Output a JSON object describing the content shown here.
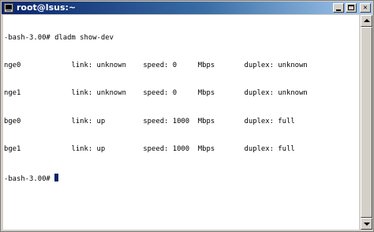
{
  "window": {
    "title": "root@lsus:~",
    "minimize_glyph": "_",
    "maximize_glyph": "□",
    "close_glyph": "✕"
  },
  "terminal": {
    "lines": [
      "-bash-3.00# dladm show-dev",
      "nge0            link: unknown    speed: 0     Mbps       duplex: unknown",
      "nge1            link: unknown    speed: 0     Mbps       duplex: unknown",
      "bge0            link: up         speed: 1000  Mbps       duplex: full",
      "bge1            link: up         speed: 1000  Mbps       duplex: full"
    ],
    "prompt": "-bash-3.00# ",
    "cursor_color": "#0a246a",
    "background_color": "#ffffff",
    "text_color": "#000000"
  },
  "colors": {
    "titlebar_start": "#0a246a",
    "titlebar_end": "#a6caf0",
    "chrome": "#d4d0c8"
  },
  "icons": {
    "window_icon": "terminal-icon",
    "scroll_up": "arrow-up-icon",
    "scroll_down": "arrow-down-icon"
  }
}
